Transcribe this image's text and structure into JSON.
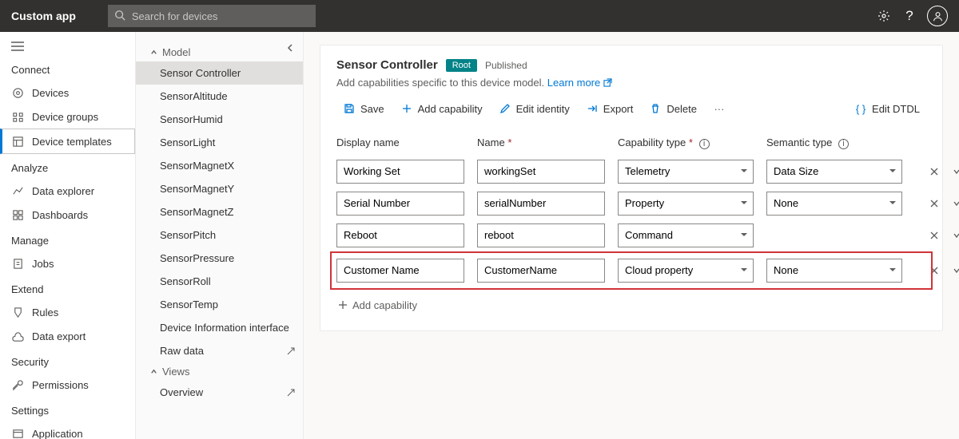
{
  "app": {
    "name": "Custom app"
  },
  "search": {
    "placeholder": "Search for devices"
  },
  "leftnav": {
    "sections": [
      {
        "label": "Connect",
        "items": [
          {
            "label": "Devices",
            "icon": "devices-icon"
          },
          {
            "label": "Device groups",
            "icon": "groups-icon"
          },
          {
            "label": "Device templates",
            "icon": "templates-icon",
            "active": true
          }
        ]
      },
      {
        "label": "Analyze",
        "items": [
          {
            "label": "Data explorer",
            "icon": "explorer-icon"
          },
          {
            "label": "Dashboards",
            "icon": "dashboards-icon"
          }
        ]
      },
      {
        "label": "Manage",
        "items": [
          {
            "label": "Jobs",
            "icon": "jobs-icon"
          }
        ]
      },
      {
        "label": "Extend",
        "items": [
          {
            "label": "Rules",
            "icon": "rules-icon"
          },
          {
            "label": "Data export",
            "icon": "export-icon"
          }
        ]
      },
      {
        "label": "Security",
        "items": [
          {
            "label": "Permissions",
            "icon": "permissions-icon"
          }
        ]
      },
      {
        "label": "Settings",
        "items": [
          {
            "label": "Application",
            "icon": "application-icon"
          }
        ]
      }
    ]
  },
  "tree": {
    "model_label": "Model",
    "views_label": "Views",
    "raw_data_label": "Raw data",
    "model_items": [
      "Sensor Controller",
      "SensorAltitude",
      "SensorHumid",
      "SensorLight",
      "SensorMagnetX",
      "SensorMagnetY",
      "SensorMagnetZ",
      "SensorPitch",
      "SensorPressure",
      "SensorRoll",
      "SensorTemp",
      "Device Information interface"
    ],
    "views_items": [
      "Overview"
    ]
  },
  "main": {
    "title": "Sensor Controller",
    "root_badge": "Root",
    "status": "Published",
    "subtext": "Add capabilities specific to this device model.",
    "learn_more": "Learn more",
    "toolbar": {
      "save": "Save",
      "add_cap": "Add capability",
      "edit_identity": "Edit identity",
      "export": "Export",
      "delete": "Delete",
      "edit_dtdl": "Edit DTDL"
    },
    "columns": {
      "display_name": "Display name",
      "name": "Name",
      "cap_type": "Capability type",
      "sem_type": "Semantic type"
    },
    "rows": [
      {
        "display": "Working Set",
        "name": "workingSet",
        "cap": "Telemetry",
        "sem": "Data Size"
      },
      {
        "display": "Serial Number",
        "name": "serialNumber",
        "cap": "Property",
        "sem": "None"
      },
      {
        "display": "Reboot",
        "name": "reboot",
        "cap": "Command",
        "sem": null
      },
      {
        "display": "Customer Name",
        "name": "CustomerName",
        "cap": "Cloud property",
        "sem": "None",
        "highlighted": true
      }
    ],
    "add_cap_inline": "Add capability"
  }
}
